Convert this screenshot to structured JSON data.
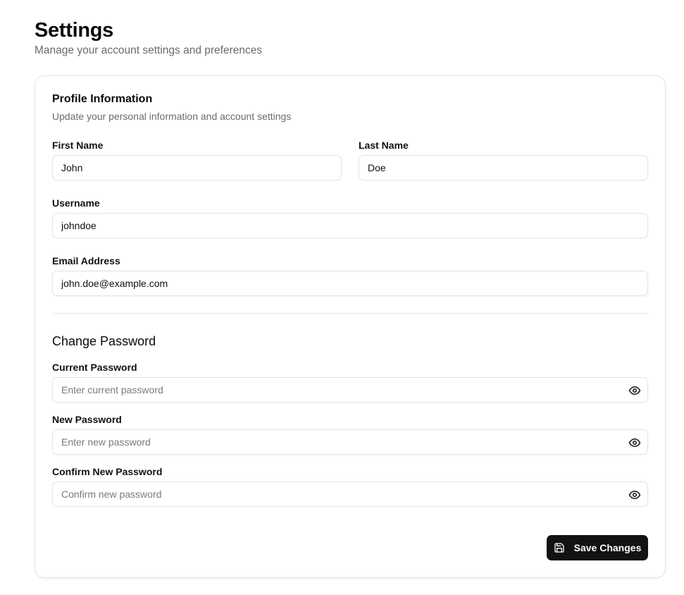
{
  "page": {
    "title": "Settings",
    "subtitle": "Manage your account settings and preferences"
  },
  "profile": {
    "title": "Profile Information",
    "description": "Update your personal information and account settings",
    "first_name": {
      "label": "First Name",
      "value": "John"
    },
    "last_name": {
      "label": "Last Name",
      "value": "Doe"
    },
    "username": {
      "label": "Username",
      "value": "johndoe"
    },
    "email": {
      "label": "Email Address",
      "value": "john.doe@example.com"
    }
  },
  "password": {
    "title": "Change Password",
    "current": {
      "label": "Current Password",
      "placeholder": "Enter current password",
      "icon": "eye-icon"
    },
    "new": {
      "label": "New Password",
      "placeholder": "Enter new password",
      "icon": "eye-icon"
    },
    "confirm": {
      "label": "Confirm New Password",
      "placeholder": "Confirm new password",
      "icon": "eye-icon"
    }
  },
  "actions": {
    "save_label": "Save Changes",
    "save_icon": "save-icon"
  },
  "colors": {
    "primary_button": "#121212",
    "border": "#e3e3e3",
    "muted_text": "#6b6b6b"
  }
}
